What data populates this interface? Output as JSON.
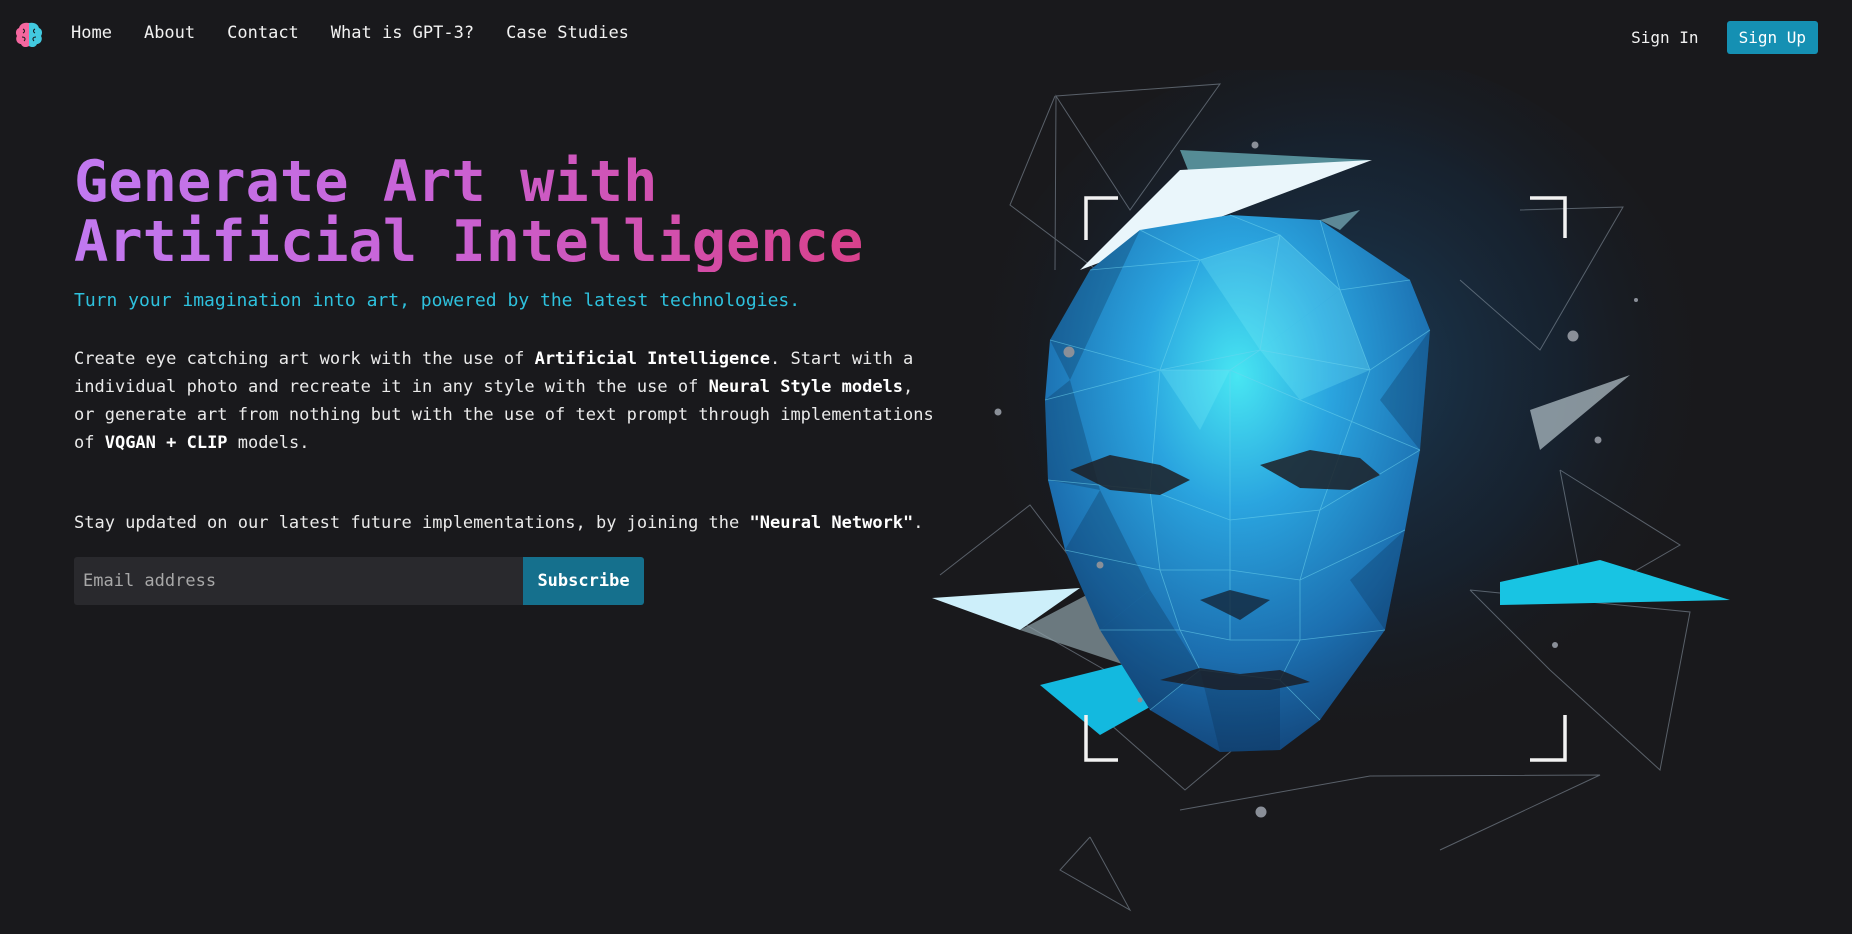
{
  "nav": {
    "logo_icon": "brain-icon",
    "links": [
      "Home",
      "About",
      "Contact",
      "What is GPT-3?",
      "Case Studies"
    ],
    "sign_in": "Sign In",
    "sign_up": "Sign Up"
  },
  "hero": {
    "title_line1": "Generate Art with",
    "title_line2": "Artificial Intelligence",
    "subtitle": "Turn your imagination into art, powered by the latest technologies.",
    "desc_1": "Create eye catching art work with the use of ",
    "desc_b1": "Artificial Intelligence",
    "desc_2": ". Start with a individual photo and recreate it in any style with the use of ",
    "desc_b2": "Neural Style models",
    "desc_3": ", or generate art from nothing but with the use of text prompt through implementations of ",
    "desc_b3": "VQGAN + CLIP",
    "desc_4": " models.",
    "newsletter_1": "Stay updated on our latest future implementations, by joining the ",
    "newsletter_b": "\"Neural Network\"",
    "newsletter_2": ".",
    "email_placeholder": "Email address",
    "subscribe": "Subscribe"
  },
  "illustration": "low-poly-face-icon",
  "colors": {
    "background": "#19191c",
    "accent": "#1590b3",
    "subtitle": "#2ec1dd",
    "title_gradient_start": "#c179f0",
    "title_gradient_end": "#da3d80"
  }
}
